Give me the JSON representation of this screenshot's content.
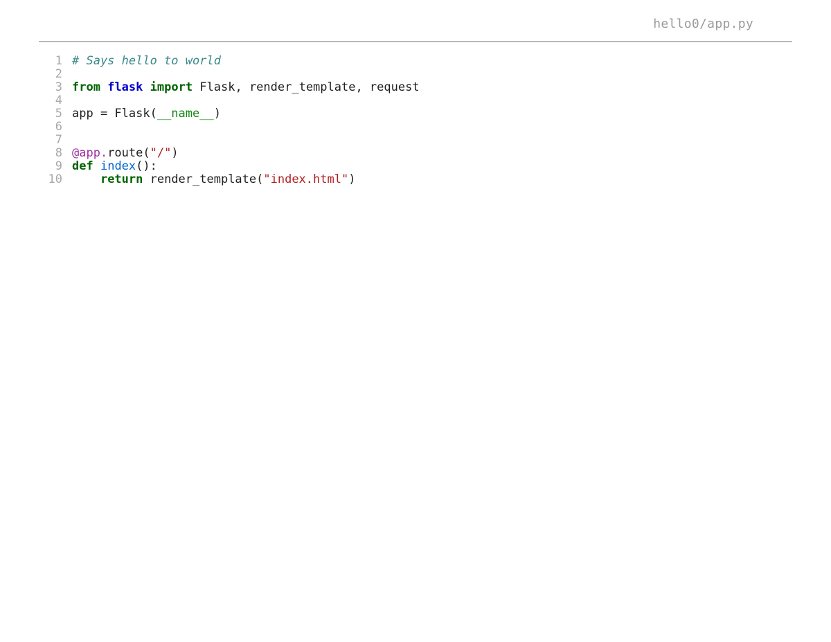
{
  "header": {
    "file_path": "hello0/app.py"
  },
  "code": {
    "lines": [
      {
        "n": "1",
        "tokens": [
          {
            "cls": "tok-comment",
            "t": "# Says hello to world"
          }
        ]
      },
      {
        "n": "2",
        "tokens": []
      },
      {
        "n": "3",
        "tokens": [
          {
            "cls": "tok-keyword",
            "t": "from"
          },
          {
            "cls": "tok-default",
            "t": " "
          },
          {
            "cls": "tok-module",
            "t": "flask"
          },
          {
            "cls": "tok-default",
            "t": " "
          },
          {
            "cls": "tok-keyword",
            "t": "import"
          },
          {
            "cls": "tok-default",
            "t": " Flask, render_template, request"
          }
        ]
      },
      {
        "n": "4",
        "tokens": []
      },
      {
        "n": "5",
        "tokens": [
          {
            "cls": "tok-default",
            "t": "app = Flask("
          },
          {
            "cls": "tok-builtin",
            "t": "__name__"
          },
          {
            "cls": "tok-default",
            "t": ")"
          }
        ]
      },
      {
        "n": "6",
        "tokens": []
      },
      {
        "n": "7",
        "tokens": []
      },
      {
        "n": "8",
        "tokens": [
          {
            "cls": "tok-decorator",
            "t": "@app."
          },
          {
            "cls": "tok-default",
            "t": "route("
          },
          {
            "cls": "tok-string",
            "t": "\"/\""
          },
          {
            "cls": "tok-default",
            "t": ")"
          }
        ]
      },
      {
        "n": "9",
        "tokens": [
          {
            "cls": "tok-keyword",
            "t": "def"
          },
          {
            "cls": "tok-default",
            "t": " "
          },
          {
            "cls": "tok-funcname",
            "t": "index"
          },
          {
            "cls": "tok-default",
            "t": "():"
          }
        ]
      },
      {
        "n": "10",
        "tokens": [
          {
            "cls": "tok-default",
            "t": "    "
          },
          {
            "cls": "tok-keyword",
            "t": "return"
          },
          {
            "cls": "tok-default",
            "t": " render_template("
          },
          {
            "cls": "tok-string",
            "t": "\"index.html\""
          },
          {
            "cls": "tok-default",
            "t": ")"
          }
        ]
      }
    ]
  }
}
